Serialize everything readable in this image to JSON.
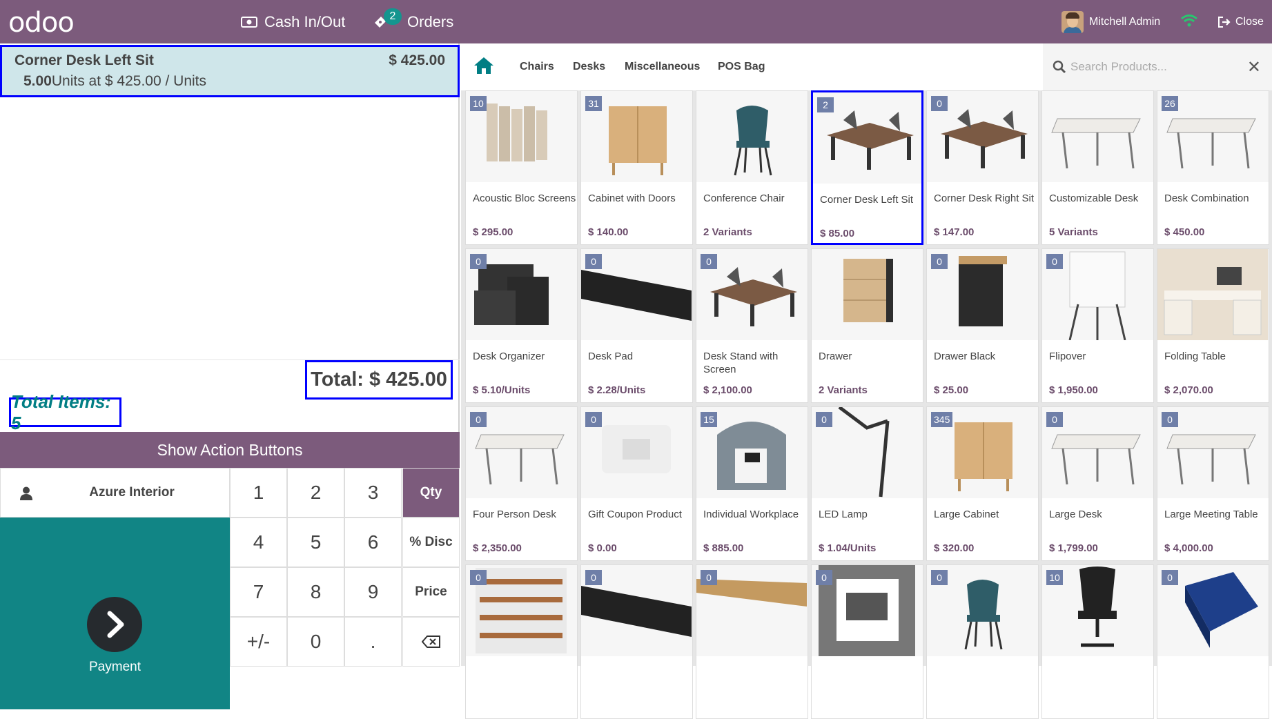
{
  "header": {
    "logo": "odoo",
    "cash_label": "Cash In/Out",
    "orders_label": "Orders",
    "orders_count": "2",
    "user_name": "Mitchell Admin",
    "close_label": "Close"
  },
  "order": {
    "line": {
      "name": "Corner Desk Left Sit",
      "price": "$ 425.00",
      "qty": "5.00",
      "unit_info": "Units at $ 425.00 / Units"
    },
    "total": "Total: $ 425.00",
    "total_items": "Total Items: 5"
  },
  "controls": {
    "action_buttons": "Show Action Buttons",
    "customer": "Azure Interior",
    "payment": "Payment",
    "keys": [
      "1",
      "2",
      "3",
      "Qty",
      "4",
      "5",
      "6",
      "% Disc",
      "7",
      "8",
      "9",
      "Price",
      "+/-",
      "0",
      "."
    ]
  },
  "categories": [
    "Chairs",
    "Desks",
    "Miscellaneous",
    "POS Bag"
  ],
  "search": {
    "placeholder": "Search Products..."
  },
  "products": [
    {
      "name": "Acoustic Bloc Screens",
      "price": "$ 295.00",
      "qty": "10",
      "icon": "acoustic-screen"
    },
    {
      "name": "Cabinet with Doors",
      "price": "$ 140.00",
      "qty": "31",
      "icon": "cabinet"
    },
    {
      "name": "Conference Chair",
      "price": "2 Variants",
      "qty": "",
      "icon": "chair"
    },
    {
      "name": "Corner Desk Left Sit",
      "price": "$ 85.00",
      "qty": "2",
      "icon": "desk"
    },
    {
      "name": "Corner Desk Right Sit",
      "price": "$ 147.00",
      "qty": "0",
      "icon": "desk"
    },
    {
      "name": "Customizable Desk",
      "price": "5 Variants",
      "qty": "",
      "icon": "table"
    },
    {
      "name": "Desk Combination",
      "price": "$ 450.00",
      "qty": "26",
      "icon": "table"
    },
    {
      "name": "Desk Organizer",
      "price": "$ 5.10/Units",
      "qty": "0",
      "icon": "organizer"
    },
    {
      "name": "Desk Pad",
      "price": "$ 2.28/Units",
      "qty": "0",
      "icon": "pad"
    },
    {
      "name": "Desk Stand with Screen",
      "price": "$ 2,100.00",
      "qty": "0",
      "icon": "desk"
    },
    {
      "name": "Drawer",
      "price": "2 Variants",
      "qty": "",
      "icon": "drawer"
    },
    {
      "name": "Drawer Black",
      "price": "$ 25.00",
      "qty": "0",
      "icon": "drawer-black"
    },
    {
      "name": "Flipover",
      "price": "$ 1,950.00",
      "qty": "0",
      "icon": "flipover"
    },
    {
      "name": "Folding Table",
      "price": "$ 2,070.00",
      "qty": "",
      "icon": "folding-table"
    },
    {
      "name": "Four Person Desk",
      "price": "$ 2,350.00",
      "qty": "0",
      "icon": "table"
    },
    {
      "name": "Gift Coupon Product",
      "price": "$ 0.00",
      "qty": "0",
      "icon": "gift"
    },
    {
      "name": "Individual Workplace",
      "price": "$ 885.00",
      "qty": "15",
      "icon": "workplace"
    },
    {
      "name": "LED Lamp",
      "price": "$ 1.04/Units",
      "qty": "0",
      "icon": "lamp"
    },
    {
      "name": "Large Cabinet",
      "price": "$ 320.00",
      "qty": "345",
      "icon": "cabinet"
    },
    {
      "name": "Large Desk",
      "price": "$ 1,799.00",
      "qty": "0",
      "icon": "table"
    },
    {
      "name": "Large Meeting Table",
      "price": "$ 4,000.00",
      "qty": "0",
      "icon": "table"
    },
    {
      "name": "",
      "price": "",
      "qty": "0",
      "icon": "shelf"
    },
    {
      "name": "",
      "price": "",
      "qty": "0",
      "icon": "pad"
    },
    {
      "name": "",
      "price": "",
      "qty": "0",
      "icon": "wood"
    },
    {
      "name": "",
      "price": "",
      "qty": "0",
      "icon": "gray"
    },
    {
      "name": "",
      "price": "",
      "qty": "0",
      "icon": "chair"
    },
    {
      "name": "",
      "price": "",
      "qty": "10",
      "icon": "chair-black"
    },
    {
      "name": "",
      "price": "",
      "qty": "0",
      "icon": "box"
    }
  ],
  "colors": {
    "header": "#7c5b7c",
    "payment": "#118585",
    "selected_line": "#cfe6ea",
    "highlight": "#0000ff"
  }
}
